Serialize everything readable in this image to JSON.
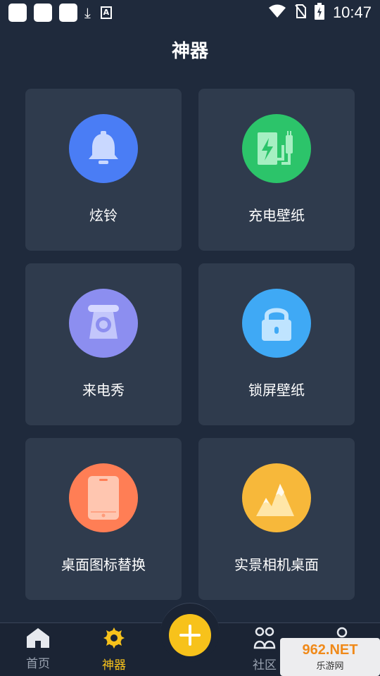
{
  "status_bar": {
    "time": "10:47"
  },
  "page": {
    "title": "神器"
  },
  "cards": [
    {
      "label": "炫铃",
      "icon": "bell-icon",
      "color": "#4a7df5"
    },
    {
      "label": "充电壁纸",
      "icon": "charging-icon",
      "color": "#2cc46a"
    },
    {
      "label": "来电秀",
      "icon": "telephone-icon",
      "color": "#8c8ef0"
    },
    {
      "label": "锁屏壁纸",
      "icon": "lock-icon",
      "color": "#3fa9f5"
    },
    {
      "label": "桌面图标替换",
      "icon": "phone-icon",
      "color": "#ff7e55"
    },
    {
      "label": "实景相机桌面",
      "icon": "mountain-icon",
      "color": "#f7b83a"
    }
  ],
  "nav": {
    "home": "首页",
    "tools": "神器",
    "community": "社区"
  },
  "watermark": {
    "brand": "962.NET",
    "name": "乐游网"
  }
}
